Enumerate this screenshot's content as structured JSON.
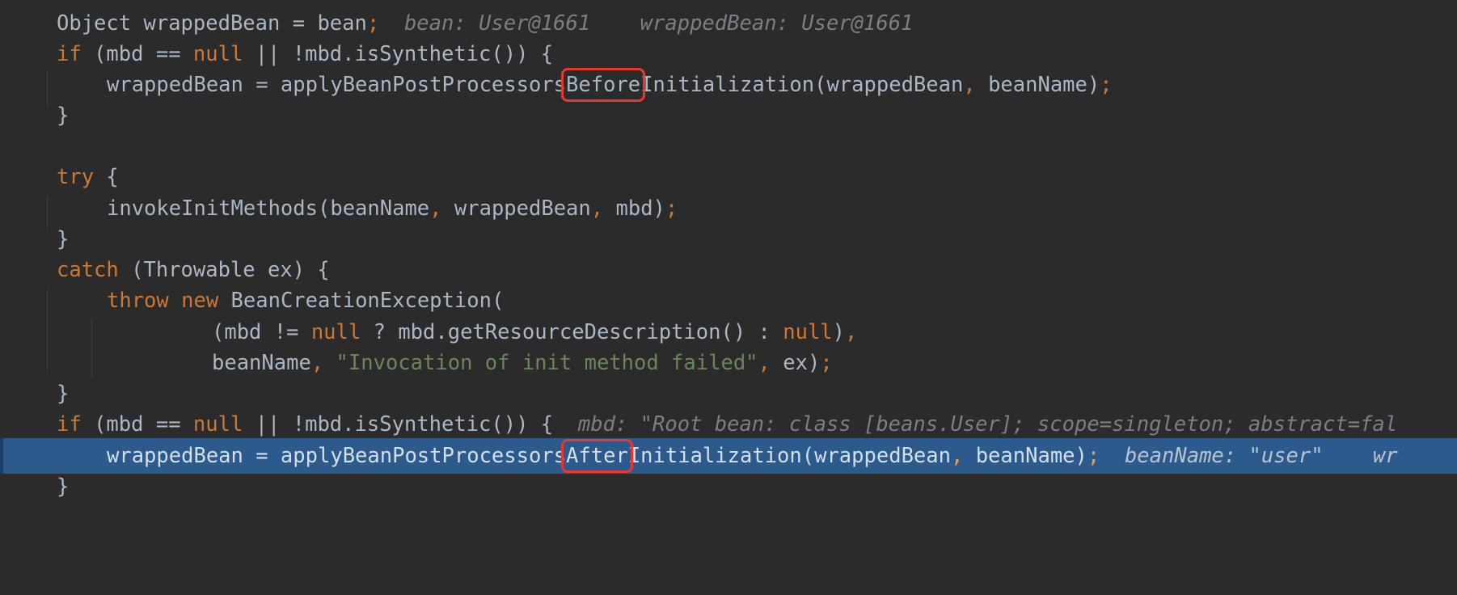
{
  "code": {
    "line1": {
      "type": "Object",
      "var": "wrappedBean",
      "eq": "=",
      "val": "bean",
      "semi": ";",
      "hint1": "bean: User@1661",
      "hint2": "wrappedBean: User@1661"
    },
    "line2": {
      "kw_if": "if",
      "pre": "(mbd ==",
      "kw_null": "null",
      "post": "|| !mbd.isSynthetic()) {"
    },
    "line3": {
      "pre": "wrappedBean = applyBeanPostProcessors",
      "mark": "Before",
      "post": "Initialization(wrappedBean",
      "comma": ",",
      "post2": "beanName)",
      "semi": ";"
    },
    "line4": {
      "brace": "}"
    },
    "line6": {
      "kw_try": "try",
      "brace": "{"
    },
    "line7": {
      "pre": "invokeInitMethods(beanName",
      "comma1": ",",
      "mid": "wrappedBean",
      "comma2": ",",
      "post": "mbd)",
      "semi": ";"
    },
    "line8": {
      "brace": "}"
    },
    "line9": {
      "kw_catch": "catch",
      "rest": "(Throwable ex) {"
    },
    "line10": {
      "kw_throw": "throw",
      "kw_new": "new",
      "rest": "BeanCreationException("
    },
    "line11": {
      "pre": "(mbd !=",
      "kw_null1": "null",
      "mid": "? mbd.getResourceDescription() :",
      "kw_null2": "null",
      "post": ")",
      "comma": ","
    },
    "line12": {
      "pre": "beanName",
      "comma1": ",",
      "str": "\"Invocation of init method failed\"",
      "comma2": ",",
      "post": "ex)",
      "semi": ";"
    },
    "line13": {
      "brace": "}"
    },
    "line14": {
      "kw_if": "if",
      "pre": "(mbd ==",
      "kw_null": "null",
      "post": "|| !mbd.isSynthetic()) {",
      "hint": "mbd: \"Root bean: class [beans.User]; scope=singleton; abstract=fal"
    },
    "line15": {
      "pre": "wrappedBean = applyBeanPostProcessors",
      "mark": "After",
      "post": "Initialization(wrappedBean",
      "comma": ",",
      "post2": "beanName)",
      "semi": ";",
      "hint1": "beanName: \"user\"",
      "hint2": "wr"
    },
    "line16": {
      "brace": "}"
    }
  },
  "colors": {
    "background": "#2b2b2b",
    "text": "#a9b7c6",
    "keyword": "#cc7832",
    "string": "#6a8759",
    "inline_hint": "#7a7e85",
    "execution_line": "#2d5a8c",
    "annotation_box": "#e8372c"
  }
}
